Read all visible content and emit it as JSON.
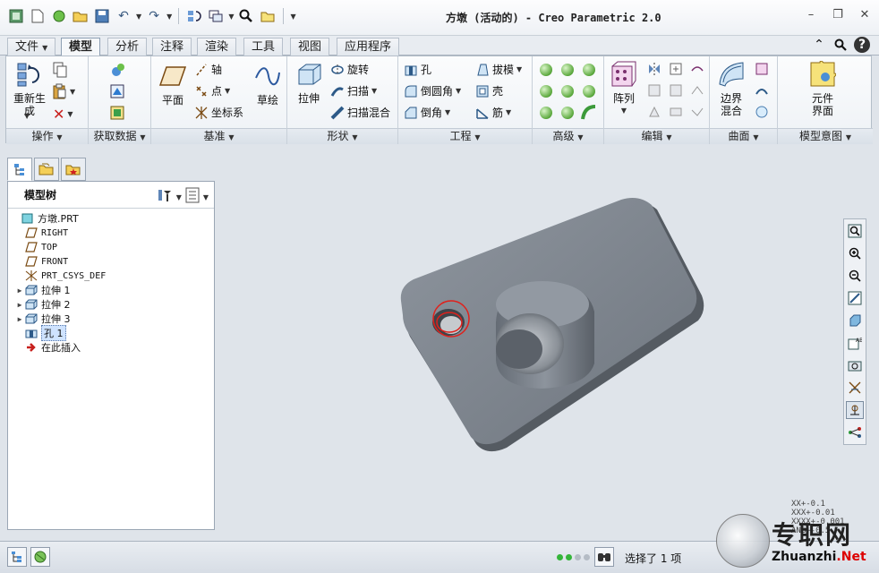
{
  "window": {
    "title": "方墩 (活动的) - Creo Parametric 2.0"
  },
  "quick_access": [
    "app-icon",
    "new-icon",
    "session-icon",
    "open-icon",
    "save-icon",
    "undo-icon",
    "redo-icon",
    "regenerate-icon",
    "windows-icon",
    "search-icon",
    "folder-icon",
    "customize-icon"
  ],
  "tabs": [
    {
      "label": "文件",
      "active": false,
      "has_dropdown": true
    },
    {
      "label": "模型",
      "active": true
    },
    {
      "label": "分析",
      "active": false
    },
    {
      "label": "注释",
      "active": false
    },
    {
      "label": "渲染",
      "active": false
    },
    {
      "label": "工具",
      "active": false
    },
    {
      "label": "视图",
      "active": false
    },
    {
      "label": "应用程序",
      "active": false
    }
  ],
  "ribbon": {
    "groups": {
      "operations": {
        "label": "操作",
        "regenerate": "重新生成"
      },
      "getdata": {
        "label": "获取数据"
      },
      "datum": {
        "label": "基准",
        "plane": "平面",
        "axis": "轴",
        "point": "点",
        "csys": "坐标系",
        "sketch": "草绘"
      },
      "shapes": {
        "label": "形状",
        "extrude": "拉伸",
        "revolve": "旋转",
        "sweep": "扫描",
        "swept_blend": "扫描混合"
      },
      "engineering": {
        "label": "工程",
        "hole": "孔",
        "round": "倒圆角",
        "chamfer": "倒角",
        "draft": "拔模",
        "shell": "壳",
        "rib": "筋"
      },
      "advanced": {
        "label": "高级"
      },
      "editing": {
        "label": "编辑",
        "pattern": "阵列"
      },
      "surfaces": {
        "label": "曲面",
        "boundary_blend": "边界混合"
      },
      "model_intent": {
        "label": "模型意图",
        "component_interface": "元件界面"
      }
    }
  },
  "tree": {
    "title": "模型树",
    "items": [
      {
        "label": "方墩.PRT",
        "icon": "part-icon",
        "expandable": false,
        "indent": 0,
        "cjk": true
      },
      {
        "label": "RIGHT",
        "icon": "datum-plane-icon",
        "expandable": false,
        "indent": 1
      },
      {
        "label": "TOP",
        "icon": "datum-plane-icon",
        "expandable": false,
        "indent": 1
      },
      {
        "label": "FRONT",
        "icon": "datum-plane-icon",
        "expandable": false,
        "indent": 1
      },
      {
        "label": "PRT_CSYS_DEF",
        "icon": "csys-icon",
        "expandable": false,
        "indent": 1
      },
      {
        "label": "拉伸 1",
        "icon": "extrude-icon",
        "expandable": true,
        "indent": 1,
        "cjk": true
      },
      {
        "label": "拉伸 2",
        "icon": "extrude-icon",
        "expandable": true,
        "indent": 1,
        "cjk": true
      },
      {
        "label": "拉伸 3",
        "icon": "extrude-icon",
        "expandable": true,
        "indent": 1,
        "cjk": true
      },
      {
        "label": "孔 1",
        "icon": "hole-icon",
        "expandable": false,
        "indent": 1,
        "cjk": true,
        "selected": true
      },
      {
        "label": "在此插入",
        "icon": "insert-arrow-icon",
        "expandable": false,
        "indent": 1,
        "cjk": true
      }
    ]
  },
  "status": {
    "message": "选择了 1 项"
  },
  "tolerance": [
    "XX+-0.1",
    "XXX+-0.01",
    "XXXX+-0.001",
    "ANG+-0.5"
  ],
  "watermark": {
    "text": "专职网",
    "url_prefix": "Zhuanzhi",
    "url_suffix": ".Net"
  },
  "colors": {
    "model": "#7d858f",
    "selection": "#e0201b",
    "accent": "#35b53a"
  }
}
